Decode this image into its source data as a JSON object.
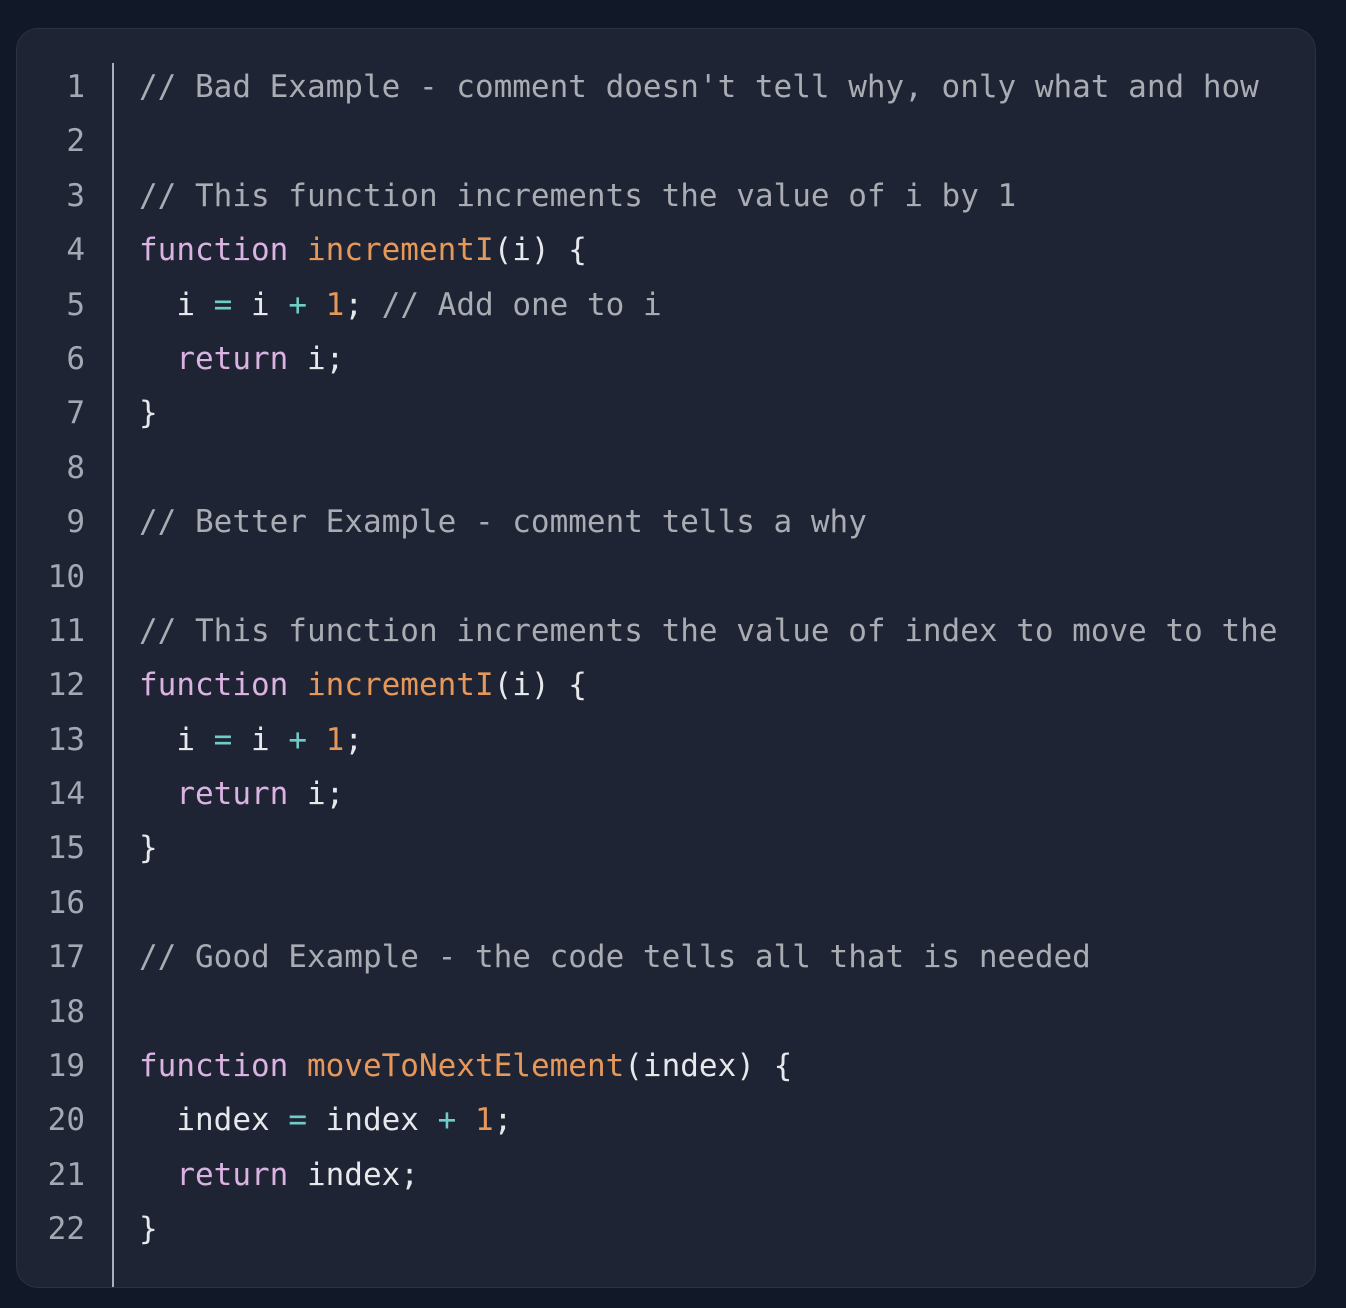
{
  "colors": {
    "background": "#111827",
    "card": "#1e2433",
    "comment": "#a9acb2",
    "keyword": "#dbb3e2",
    "function": "#e6985a",
    "number": "#e6985a",
    "operator": "#6ecdc9",
    "text": "#e6e8eb",
    "line_number": "#a3a8b3"
  },
  "code": {
    "language": "javascript",
    "lines": [
      {
        "number": "1",
        "tokens": [
          {
            "t": "comment",
            "v": "// Bad Example - comment doesn't tell why, only what and how"
          }
        ]
      },
      {
        "number": "2",
        "tokens": []
      },
      {
        "number": "3",
        "tokens": [
          {
            "t": "comment",
            "v": "// This function increments the value of i by 1"
          }
        ]
      },
      {
        "number": "4",
        "tokens": [
          {
            "t": "keyword",
            "v": "function"
          },
          {
            "t": "text",
            "v": " "
          },
          {
            "t": "fn",
            "v": "incrementI"
          },
          {
            "t": "text",
            "v": "(i) {"
          }
        ]
      },
      {
        "number": "5",
        "tokens": [
          {
            "t": "text",
            "v": "  i "
          },
          {
            "t": "op",
            "v": "="
          },
          {
            "t": "text",
            "v": " i "
          },
          {
            "t": "op",
            "v": "+"
          },
          {
            "t": "text",
            "v": " "
          },
          {
            "t": "num",
            "v": "1"
          },
          {
            "t": "text",
            "v": "; "
          },
          {
            "t": "comment",
            "v": "// Add one to i"
          }
        ]
      },
      {
        "number": "6",
        "tokens": [
          {
            "t": "text",
            "v": "  "
          },
          {
            "t": "keyword",
            "v": "return"
          },
          {
            "t": "text",
            "v": " i;"
          }
        ]
      },
      {
        "number": "7",
        "tokens": [
          {
            "t": "text",
            "v": "}"
          }
        ]
      },
      {
        "number": "8",
        "tokens": []
      },
      {
        "number": "9",
        "tokens": [
          {
            "t": "comment",
            "v": "// Better Example - comment tells a why"
          }
        ]
      },
      {
        "number": "10",
        "tokens": []
      },
      {
        "number": "11",
        "tokens": [
          {
            "t": "comment",
            "v": "// This function increments the value of index to move to the"
          }
        ]
      },
      {
        "number": "12",
        "tokens": [
          {
            "t": "keyword",
            "v": "function"
          },
          {
            "t": "text",
            "v": " "
          },
          {
            "t": "fn",
            "v": "incrementI"
          },
          {
            "t": "text",
            "v": "(i) {"
          }
        ]
      },
      {
        "number": "13",
        "tokens": [
          {
            "t": "text",
            "v": "  i "
          },
          {
            "t": "op",
            "v": "="
          },
          {
            "t": "text",
            "v": " i "
          },
          {
            "t": "op",
            "v": "+"
          },
          {
            "t": "text",
            "v": " "
          },
          {
            "t": "num",
            "v": "1"
          },
          {
            "t": "text",
            "v": ";"
          }
        ]
      },
      {
        "number": "14",
        "tokens": [
          {
            "t": "text",
            "v": "  "
          },
          {
            "t": "keyword",
            "v": "return"
          },
          {
            "t": "text",
            "v": " i;"
          }
        ]
      },
      {
        "number": "15",
        "tokens": [
          {
            "t": "text",
            "v": "}"
          }
        ]
      },
      {
        "number": "16",
        "tokens": []
      },
      {
        "number": "17",
        "tokens": [
          {
            "t": "comment",
            "v": "// Good Example - the code tells all that is needed"
          }
        ]
      },
      {
        "number": "18",
        "tokens": []
      },
      {
        "number": "19",
        "tokens": [
          {
            "t": "keyword",
            "v": "function"
          },
          {
            "t": "text",
            "v": " "
          },
          {
            "t": "fn",
            "v": "moveToNextElement"
          },
          {
            "t": "text",
            "v": "(index) {"
          }
        ]
      },
      {
        "number": "20",
        "tokens": [
          {
            "t": "text",
            "v": "  index "
          },
          {
            "t": "op",
            "v": "="
          },
          {
            "t": "text",
            "v": " index "
          },
          {
            "t": "op",
            "v": "+"
          },
          {
            "t": "text",
            "v": " "
          },
          {
            "t": "num",
            "v": "1"
          },
          {
            "t": "text",
            "v": ";"
          }
        ]
      },
      {
        "number": "21",
        "tokens": [
          {
            "t": "text",
            "v": "  "
          },
          {
            "t": "keyword",
            "v": "return"
          },
          {
            "t": "text",
            "v": " index;"
          }
        ]
      },
      {
        "number": "22",
        "tokens": [
          {
            "t": "text",
            "v": "}"
          }
        ]
      }
    ]
  }
}
